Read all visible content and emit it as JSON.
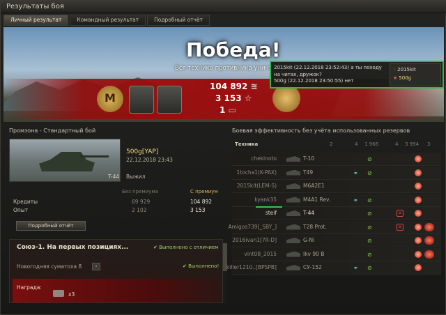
{
  "window": {
    "title": "Результаты боя"
  },
  "tabs": [
    {
      "label": "Личный результат",
      "active": true
    },
    {
      "label": "Командный результат",
      "active": false
    },
    {
      "label": "Подробный отчёт",
      "active": false
    }
  ],
  "banner": {
    "title": "Победа!",
    "subtitle": "Вся техника противника уничтожена",
    "credits": "104 892",
    "xp": "3 153",
    "items": "1",
    "medal_letter": "M"
  },
  "notification": {
    "line1": "2015kit (22.12.2018 23:52:43) а ты походу",
    "line2": "на читах, дружок?",
    "line3": "500g (22.12.2018 23:50:55) нет",
    "list": [
      {
        "name": "2015kit"
      },
      {
        "name": "500g"
      }
    ]
  },
  "left_panel": {
    "header": "Промзона - Стандартный бой",
    "player": "500g[YAP]",
    "date": "22.12.2018 23:43",
    "tank": "T-44",
    "status": "Выжил",
    "col_no_premium": "Без премиума",
    "col_premium": "С премиум",
    "rows": [
      {
        "label": "Кредиты",
        "base": "69 929",
        "prem": "104 892"
      },
      {
        "label": "Опыт",
        "base": "2 102",
        "prem": "3 153"
      }
    ],
    "detail_button": "Подробный отчёт"
  },
  "quests": {
    "title": "Союз-1. На первых позициях...",
    "done_honors": "Выполнено с отличием",
    "subquest": "Новогодняя суматоха 8",
    "done": "Выполнено!",
    "reward_label": "Награда:",
    "reward_count": "x3"
  },
  "right_panel": {
    "header": "Боевая эффективность без учёта использованных резервов",
    "col_tech": "Техника",
    "col_values": [
      "2",
      "4",
      "1 966",
      "4",
      "3 994",
      "3"
    ],
    "rows": [
      {
        "player": "chekinoto",
        "tank": "T-10",
        "me": false,
        "g1": false,
        "g2": true,
        "redx": false,
        "big": false
      },
      {
        "player": "1tocha1(K-PAX)",
        "tank": "T49",
        "me": false,
        "g1": true,
        "g2": true,
        "redx": false,
        "big": false
      },
      {
        "player": "2015kit(LEM-S)",
        "tank": "M6A2E1",
        "me": false,
        "g1": false,
        "g2": false,
        "redx": false,
        "big": false
      },
      {
        "player": "kyank35",
        "tank": "M4A1 Rev.",
        "me": false,
        "g1": true,
        "g2": true,
        "redx": false,
        "big": false
      },
      {
        "player": "steif",
        "tank": "T-44",
        "me": true,
        "g1": false,
        "g2": true,
        "redx": true,
        "big": false
      },
      {
        "player": "Amigos739[_SBY_]",
        "tank": "T28 Prot.",
        "me": false,
        "g1": false,
        "g2": true,
        "redx": true,
        "big": true
      },
      {
        "player": "2016ivan1[7R-D]",
        "tank": "G-Ni",
        "me": false,
        "g1": false,
        "g2": true,
        "redx": false,
        "big": true
      },
      {
        "player": "vint08_2015",
        "tank": "Ikv 90 B",
        "me": false,
        "g1": false,
        "g2": true,
        "redx": false,
        "big": true
      },
      {
        "player": "killer1210..[BPSPB]",
        "tank": "СУ-152",
        "me": false,
        "g1": true,
        "g2": true,
        "redx": false,
        "big": false
      }
    ]
  },
  "colors": {
    "victory_red": "#9b0f10",
    "highlight_green": "#2fb84a",
    "gold": "#f0d97a"
  }
}
